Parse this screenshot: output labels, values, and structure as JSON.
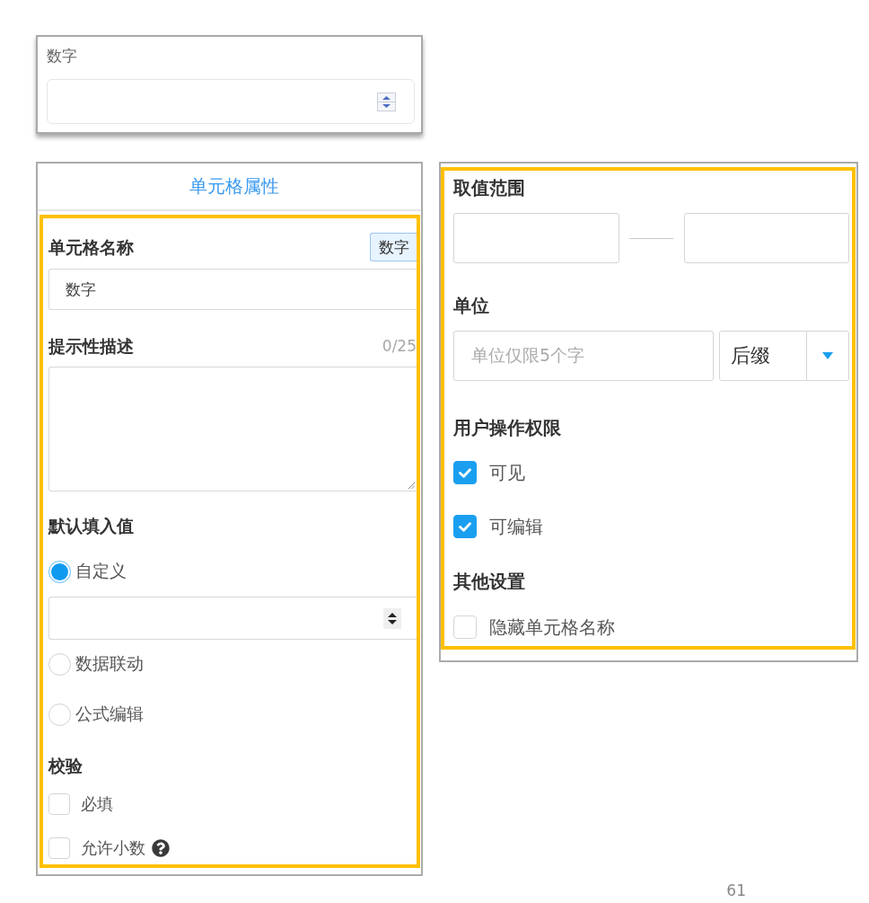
{
  "preview_card": {
    "label": "数字"
  },
  "properties_panel": {
    "title": "单元格属性",
    "cell_name": {
      "label": "单元格名称",
      "type_tag": "数字",
      "value": "数字"
    },
    "description": {
      "label": "提示性描述",
      "counter": "0/25"
    },
    "default_value": {
      "label": "默认填入值",
      "options": [
        {
          "label": "自定义",
          "selected": true
        },
        {
          "label": "数据联动",
          "selected": false
        },
        {
          "label": "公式编辑",
          "selected": false
        }
      ]
    },
    "validation": {
      "label": "校验",
      "options": [
        {
          "label": "必填",
          "checked": false,
          "help": false
        },
        {
          "label": "允许小数",
          "checked": false,
          "help": true
        }
      ]
    }
  },
  "settings_panel": {
    "range": {
      "label": "取值范围"
    },
    "unit": {
      "label": "单位",
      "placeholder": "单位仅限5个字",
      "position": "后缀"
    },
    "permissions": {
      "label": "用户操作权限",
      "options": [
        {
          "label": "可见",
          "checked": true
        },
        {
          "label": "可编辑",
          "checked": true
        }
      ]
    },
    "other_settings": {
      "label": "其他设置",
      "options": [
        {
          "label": "隐藏单元格名称",
          "checked": false
        }
      ]
    }
  },
  "page_number": "61"
}
